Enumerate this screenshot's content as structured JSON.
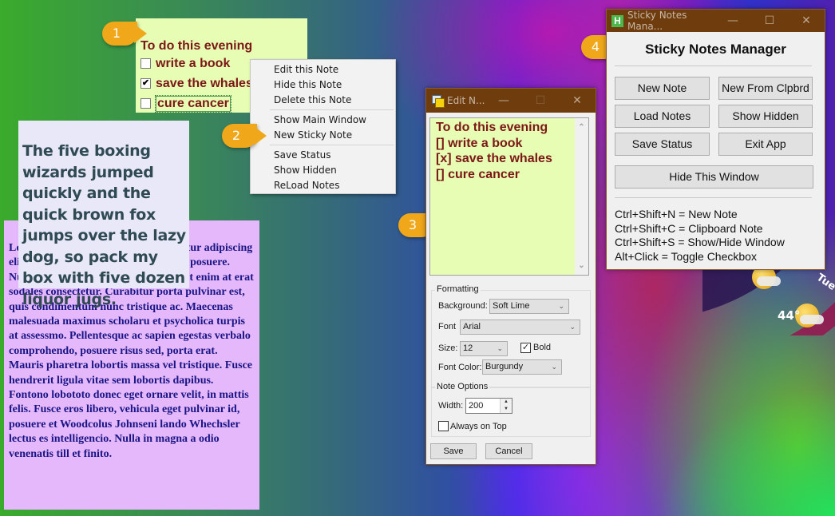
{
  "callouts": [
    "1",
    "2",
    "3",
    "4"
  ],
  "todo_note": {
    "title": "To do this evening",
    "items": [
      {
        "label": "write a book",
        "checked": false,
        "check_glyph": ""
      },
      {
        "label": "save the whales",
        "checked": true,
        "check_glyph": "✔"
      },
      {
        "label": "cure cancer",
        "checked": false,
        "check_glyph": ""
      }
    ],
    "background": "#e6fdb3",
    "font_color": "#7b1717"
  },
  "context_menu": {
    "groups": [
      [
        "Edit this Note",
        "Hide this Note",
        "Delete this Note"
      ],
      [
        "Show Main Window",
        "New Sticky Note"
      ],
      [
        "Save Status",
        "Show Hidden",
        "ReLoad Notes"
      ]
    ]
  },
  "pangram_note": {
    "text": "The five boxing wizards jumped quickly and the quick brown fox jumps over the lazy dog, so pack my box with five dozen liquor jugs.",
    "background": "#e8e8f8",
    "font_color": "#2f4a52"
  },
  "lorem_note": {
    "text": "Lorem ipsum dolor sit amet, consectetur adipiscing elit. Donec euismod, nisl eget ultricies posuere. Nullam eu mi turpis. Aliquam placerat enim at erat sodales consectetur. Curabitur porta pulvinar est, quis condimentum nunc tristique ac. Maecenas malesuada maximus scholaru et psycholica turpis at assessmo. Pellentesque ac sapien egestas verbalo comprohendo, posuere risus sed, porta erat. Mauris pharetra lobortis massa vel tristique. Fusce hendrerit ligula vitae sem lobortis dapibus. Fontono lobototo donec eget ornare velit, in mattis felis. Fusce eros libero, vehicula eget pulvinar id, posuere et Woodcolus Johnseni lando Whechsler lectus es intelligencio.  Nulla in magna a odio venenatis till et finito.",
    "background": "#e4b8fb",
    "font_color": "#1a1585"
  },
  "edit_window": {
    "title": "Edit N...",
    "minimize": "—",
    "maximize": "☐",
    "close": "✕",
    "content_lines": [
      "To do this evening",
      "[] write a book",
      "[x] save the whales",
      "[] cure cancer"
    ],
    "scroll_up": "⌃",
    "scroll_down": "⌄",
    "formatting": {
      "legend": "Formatting",
      "background_label": "Background:",
      "background_value": "Soft Lime",
      "font_label": "Font",
      "font_value": "Arial",
      "size_label": "Size:",
      "size_value": "12",
      "bold_label": "Bold",
      "bold_checked": true,
      "bold_glyph": "✓",
      "font_color_label": "Font Color:",
      "font_color_value": "Burgundy"
    },
    "note_options": {
      "legend": "Note Options",
      "width_label": "Width:",
      "width_value": "200",
      "always_on_top_label": "Always on Top",
      "always_on_top_checked": false
    },
    "save_label": "Save",
    "cancel_label": "Cancel"
  },
  "manager_window": {
    "title": "Sticky Notes Mana...",
    "app_icon_letter": "H",
    "minimize": "—",
    "maximize": "☐",
    "close": "✕",
    "heading": "Sticky Notes Manager",
    "buttons": {
      "new_note": "New Note",
      "new_from_clipboard": "New From Clpbrd",
      "load_notes": "Load Notes",
      "show_hidden": "Show Hidden",
      "save_status": "Save Status",
      "exit_app": "Exit App",
      "hide_window": "Hide This Window"
    },
    "shortcuts": [
      "Ctrl+Shift+N = New Note",
      "Ctrl+Shift+C = Clipboard Note",
      "Ctrl+Shift+S = Show/Hide Window",
      "Alt+Click = Toggle Checkbox"
    ]
  },
  "weather_widget": {
    "day": "Tue",
    "temperature": "44°"
  },
  "chevron": "⌄",
  "spin_up": "▲",
  "spin_down": "▼"
}
